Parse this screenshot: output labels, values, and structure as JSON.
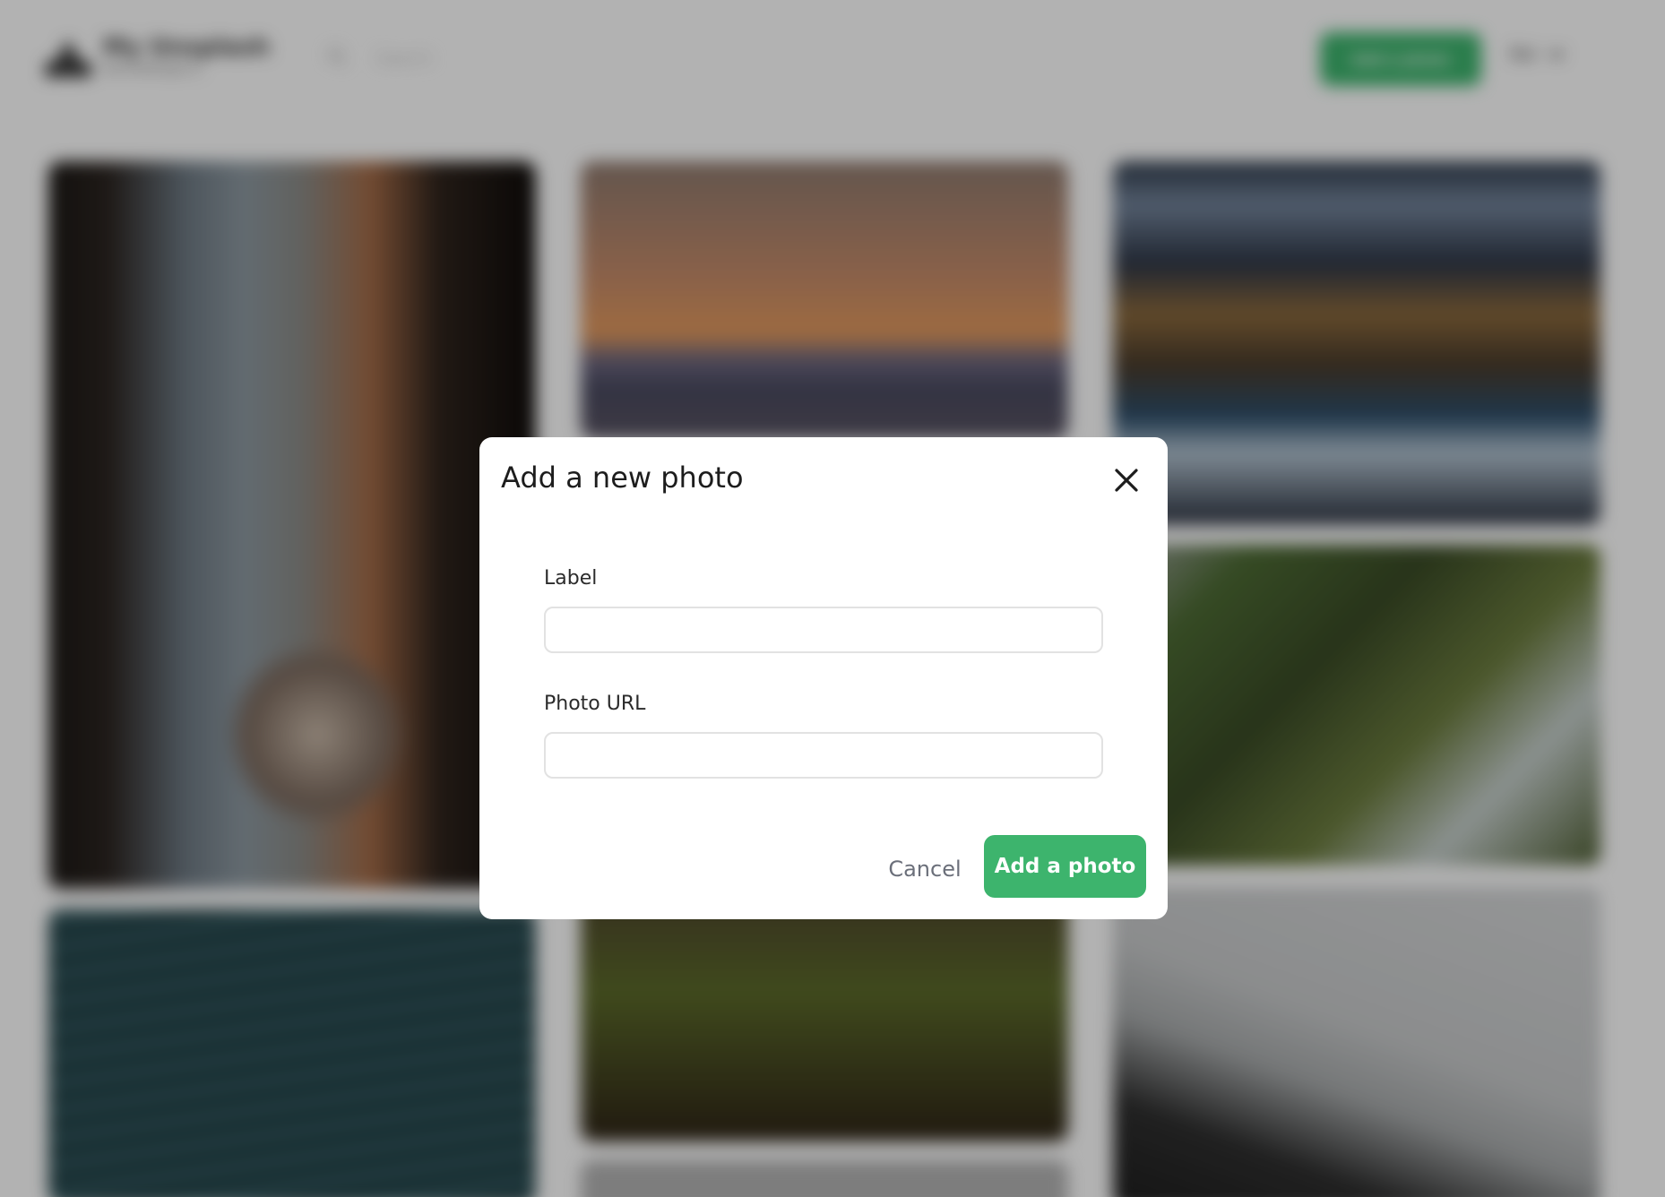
{
  "header": {
    "brand_title": "My Unsplash",
    "brand_subtitle": "devchallenges.io",
    "search_placeholder": "Search",
    "add_photo_label": "Add a photo",
    "user_name": "Nai"
  },
  "modal": {
    "title": "Add a new photo",
    "label_field": {
      "label": "Label",
      "value": "",
      "placeholder": ""
    },
    "url_field": {
      "label": "Photo URL",
      "value": "",
      "placeholder": ""
    },
    "cancel_label": "Cancel",
    "submit_label": "Add a photo"
  },
  "colors": {
    "accent": "#3db46d",
    "overlay": "rgba(0,0,0,0.30)",
    "title_text": "#1d1d1d",
    "muted_text": "#6b6f7a"
  },
  "icons": [
    "logo-icon",
    "search-icon",
    "chevron-down-icon",
    "close-icon"
  ]
}
